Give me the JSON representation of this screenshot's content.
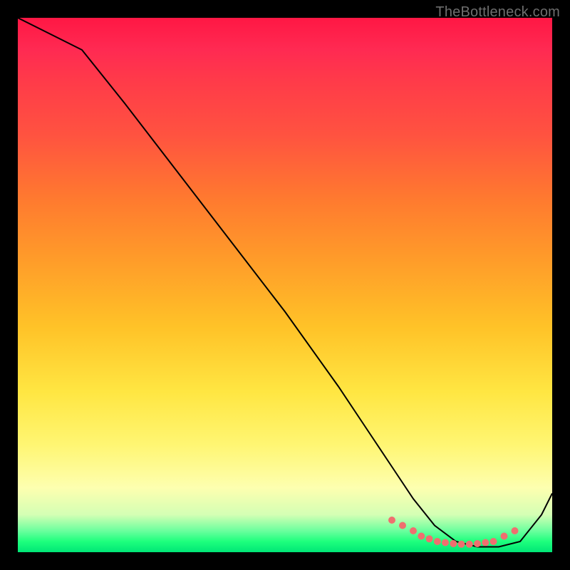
{
  "watermark": "TheBottleneck.com",
  "chart_data": {
    "type": "line",
    "title": "",
    "xlabel": "",
    "ylabel": "",
    "xlim": [
      0,
      100
    ],
    "ylim": [
      0,
      100
    ],
    "grid": false,
    "series": [
      {
        "name": "curve",
        "stroke": "#000000",
        "stroke_width": 2,
        "x": [
          0,
          4,
          8,
          12,
          20,
          30,
          40,
          50,
          60,
          66,
          70,
          74,
          78,
          82,
          86,
          90,
          94,
          98,
          100
        ],
        "y": [
          100,
          98,
          96,
          94,
          84,
          71,
          58,
          45,
          31,
          22,
          16,
          10,
          5,
          2,
          1,
          1,
          2,
          7,
          11
        ]
      }
    ],
    "markers": {
      "name": "valley-dots",
      "color": "#ef6f6f",
      "radius": 5,
      "x": [
        70,
        72,
        74,
        75.5,
        77,
        78.5,
        80,
        81.5,
        83,
        84.5,
        86,
        87.5,
        89,
        91,
        93
      ],
      "y": [
        6,
        5,
        4,
        3,
        2.5,
        2,
        1.8,
        1.6,
        1.5,
        1.5,
        1.6,
        1.8,
        2,
        3,
        4
      ]
    },
    "background_gradient": {
      "stops": [
        {
          "pct": 0,
          "color": "#ff1744"
        },
        {
          "pct": 22,
          "color": "#ff5340"
        },
        {
          "pct": 46,
          "color": "#ff9e29"
        },
        {
          "pct": 70,
          "color": "#ffe642"
        },
        {
          "pct": 88,
          "color": "#fdffb0"
        },
        {
          "pct": 96,
          "color": "#6bff9e"
        },
        {
          "pct": 100,
          "color": "#00e676"
        }
      ]
    }
  }
}
